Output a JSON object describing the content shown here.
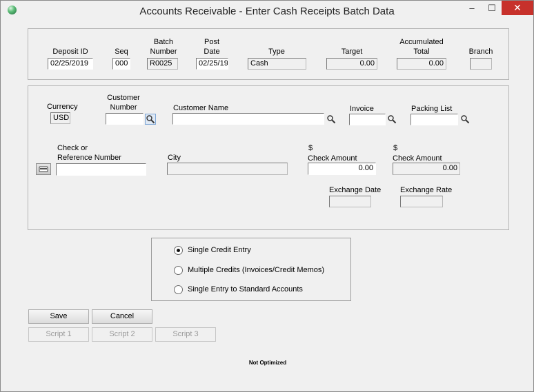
{
  "window": {
    "title": "Accounts Receivable - Enter Cash Receipts Batch Data",
    "minimize_glyph": "–",
    "maximize_glyph": "☐",
    "close_glyph": "✕"
  },
  "batch": {
    "deposit_id_label": "Deposit ID",
    "deposit_id_value": "02/25/2019",
    "seq_label": "Seq",
    "seq_value": "000",
    "batch_number_label_1": "Batch",
    "batch_number_label_2": "Number",
    "batch_number_value": "R0025",
    "post_date_label_1": "Post",
    "post_date_label_2": "Date",
    "post_date_value": "02/25/19",
    "type_label": "Type",
    "type_value": "Cash",
    "target_label": "Target",
    "target_value": "0.00",
    "accum_total_label_1": "Accumulated",
    "accum_total_label_2": "Total",
    "accum_total_value": "0.00",
    "branch_label": "Branch",
    "branch_value": ""
  },
  "entry": {
    "currency_label": "Currency",
    "currency_value": "USD",
    "customer_number_label_1": "Customer",
    "customer_number_label_2": "Number",
    "customer_number_value": "",
    "customer_name_label": "Customer Name",
    "customer_name_value": "",
    "invoice_label": "Invoice",
    "invoice_value": "",
    "packing_list_label": "Packing List",
    "packing_list_value": "",
    "check_ref_label_1": "Check or",
    "check_ref_label_2": "Reference Number",
    "check_ref_value": "",
    "city_label": "City",
    "city_value": "",
    "check_amount_1_currency": "$",
    "check_amount_1_label": "Check Amount",
    "check_amount_1_value": "0.00",
    "check_amount_2_currency": "$",
    "check_amount_2_label": "Check Amount",
    "check_amount_2_value": "0.00",
    "exchange_date_label": "Exchange Date",
    "exchange_date_value": "",
    "exchange_rate_label": "Exchange Rate",
    "exchange_rate_value": ""
  },
  "options": {
    "selected": "single_credit",
    "single_credit_label": "Single Credit Entry",
    "multiple_credits_label": "Multiple Credits (Invoices/Credit Memos)",
    "standard_accounts_label": "Single Entry to Standard Accounts"
  },
  "buttons": {
    "save_label": "Save",
    "cancel_label": "Cancel",
    "script1_label": "Script 1",
    "script2_label": "Script 2",
    "script3_label": "Script 3"
  },
  "footer": {
    "note": "Not Optimized"
  },
  "icons": {
    "app": "app-globe-icon",
    "lookup": "magnifier-icon",
    "card": "card-reader-icon"
  },
  "colors": {
    "close_button": "#c7312b",
    "window_bg": "#f0f0f0",
    "lookup_highlight": "#dfe9f5"
  }
}
